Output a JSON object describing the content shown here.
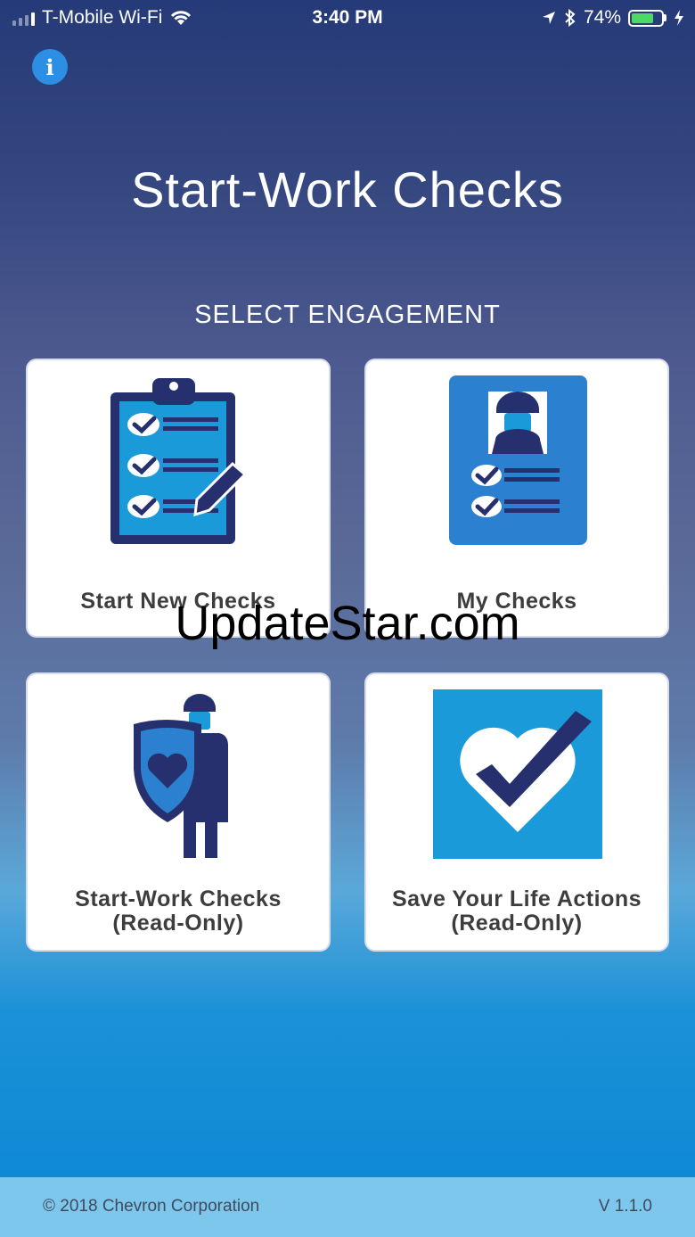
{
  "status_bar": {
    "carrier": "T-Mobile Wi-Fi",
    "time": "3:40 PM",
    "battery": "74%",
    "battery_level": 0.74,
    "icons": [
      "signal-icon",
      "wifi-icon",
      "location-icon",
      "bluetooth-icon",
      "battery-icon",
      "charging-icon"
    ]
  },
  "header": {
    "info_label": "i",
    "title": "Start-Work Checks",
    "subtitle": "SELECT ENGAGEMENT"
  },
  "tiles": [
    {
      "label": "Start New Checks",
      "icon": "clipboard-checklist-icon"
    },
    {
      "label": "My Checks",
      "icon": "worker-profile-checklist-icon"
    },
    {
      "label_line1": "Start-Work Checks",
      "label_line2": "(Read-Only)",
      "icon": "worker-shield-heart-icon"
    },
    {
      "label_line1": "Save Your Life Actions",
      "label_line2": "(Read-Only)",
      "icon": "heart-checkmark-icon"
    }
  ],
  "watermark": "UpdateStar.com",
  "footer": {
    "copyright": "© 2018 Chevron Corporation",
    "version": "V 1.1.0"
  },
  "colors": {
    "icon_dark": "#27306f",
    "icon_light": "#1b9ad9",
    "icon_mid": "#2c80d0",
    "footer_bg": "#7ec7ec"
  }
}
